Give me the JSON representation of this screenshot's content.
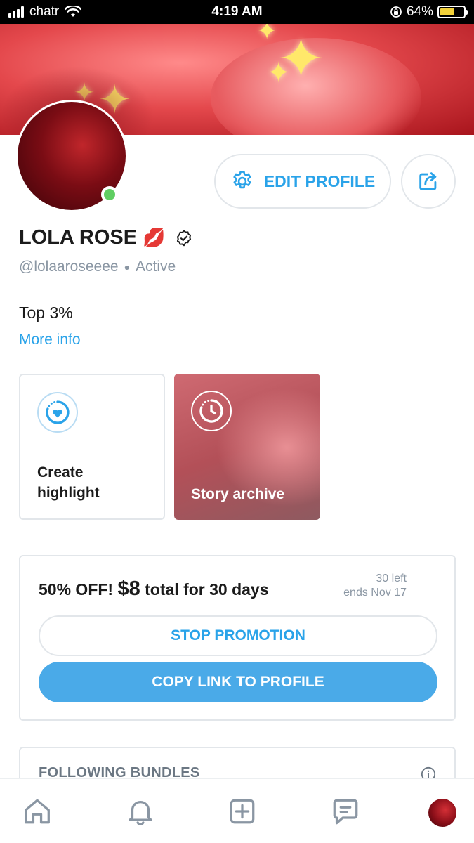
{
  "status_bar": {
    "carrier": "chatr",
    "time": "4:19 AM",
    "battery_percent": "64%",
    "battery_level": 0.64
  },
  "profile": {
    "name": "LOLA ROSE",
    "name_emoji": "💋",
    "handle": "@lolaaroseeee",
    "status": "Active",
    "rank": "Top 3%",
    "more_info": "More info",
    "edit_profile_label": "EDIT PROFILE"
  },
  "highlights": {
    "create_label": "Create highlight",
    "archive_label": "Story archive"
  },
  "promotion": {
    "discount": "50% OFF!",
    "price": "$8",
    "duration": "total for 30 days",
    "left": "30 left",
    "ends": "ends Nov 17",
    "stop_label": "STOP PROMOTION",
    "copy_label": "COPY LINK TO PROFILE"
  },
  "bundles": {
    "title": "FOLLOWING BUNDLES"
  },
  "tab_bar": {
    "icons": [
      "home-icon",
      "bell-icon",
      "plus-square-icon",
      "chat-icon",
      "avatar"
    ]
  },
  "colors": {
    "accent": "#2aa3e9",
    "button_fill": "#4aaae8",
    "online": "#5fce62",
    "muted": "#8a96a3",
    "border": "#e2e6ea"
  }
}
